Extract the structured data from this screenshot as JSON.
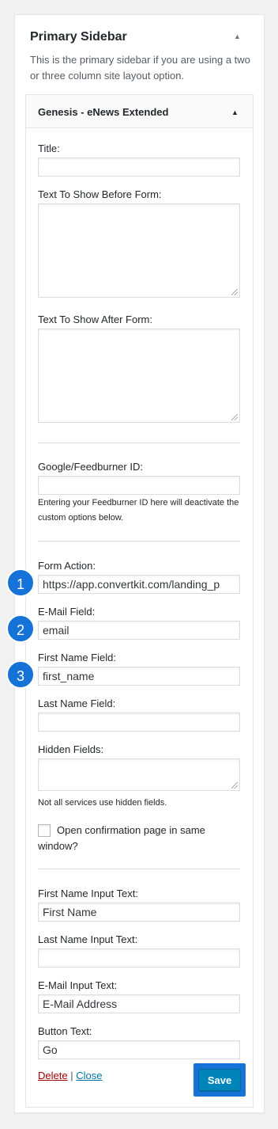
{
  "sidebar": {
    "title": "Primary Sidebar",
    "description": "This is the primary sidebar if you are using a two or three column site layout option.",
    "toggle_icon": "caret-up-icon"
  },
  "widget": {
    "title": "Genesis - eNews Extended",
    "toggle_icon": "caret-up-icon",
    "fields": {
      "title": {
        "label": "Title:",
        "value": ""
      },
      "text_before": {
        "label": "Text To Show Before Form:",
        "value": ""
      },
      "text_after": {
        "label": "Text To Show After Form:",
        "value": ""
      },
      "feedburner": {
        "label": "Google/Feedburner ID:",
        "value": "",
        "help": "Entering your Feedburner ID here will deactivate the custom options below."
      },
      "form_action": {
        "label": "Form Action:",
        "value": "https://app.convertkit.com/landing_p",
        "badge": "1"
      },
      "email_field": {
        "label": "E-Mail Field:",
        "value": "email",
        "badge": "2"
      },
      "first_name_field": {
        "label": "First Name Field:",
        "value": "first_name",
        "badge": "3"
      },
      "last_name_field": {
        "label": "Last Name Field:",
        "value": ""
      },
      "hidden_fields": {
        "label": "Hidden Fields:",
        "value": "",
        "help": "Not all services use hidden fields."
      },
      "open_same_window": {
        "label": "Open confirmation page in same window?",
        "checked": false
      },
      "first_name_input_text": {
        "label": "First Name Input Text:",
        "value": "First Name"
      },
      "last_name_input_text": {
        "label": "Last Name Input Text:",
        "value": ""
      },
      "email_input_text": {
        "label": "E-Mail Input Text:",
        "value": "E-Mail Address"
      },
      "button_text": {
        "label": "Button Text:",
        "value": "Go"
      }
    },
    "actions": {
      "delete_label": "Delete",
      "separator": "|",
      "close_label": "Close",
      "save_label": "Save"
    }
  },
  "colors": {
    "badge": "#1573d8",
    "save_button": "#0085ba",
    "delete_link": "#aa0000",
    "close_link": "#0073aa"
  }
}
